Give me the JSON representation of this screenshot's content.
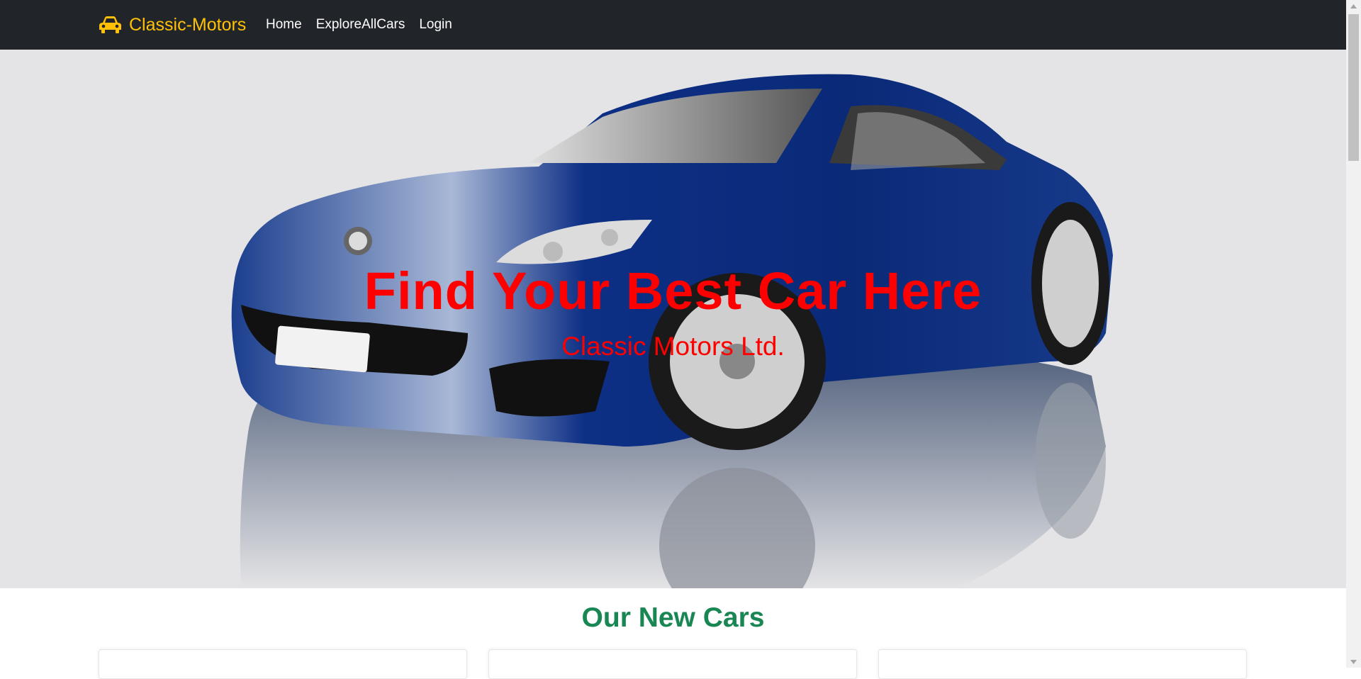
{
  "navbar": {
    "brand": "Classic-Motors",
    "links": [
      "Home",
      "ExploreAllCars",
      "Login"
    ]
  },
  "hero": {
    "title": "Find Your Best Car Here",
    "subtitle": "Classic Motors Ltd."
  },
  "section": {
    "title": "Our New Cars"
  },
  "colors": {
    "navbar_bg": "#212529",
    "brand": "#ffc107",
    "hero_text": "#ff0000",
    "section_title": "#198754"
  },
  "icons": {
    "brand": "car-icon"
  }
}
